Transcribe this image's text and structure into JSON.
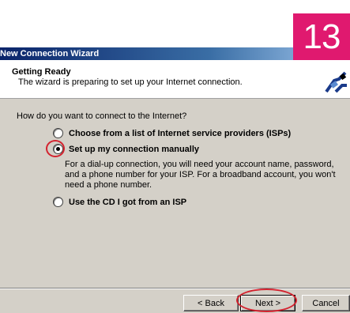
{
  "overlay": {
    "step_number": "13"
  },
  "window": {
    "title": "New Connection Wizard"
  },
  "header": {
    "title": "Getting Ready",
    "subtitle": "The wizard is preparing to set up your Internet connection."
  },
  "body": {
    "question": "How do you want to connect to the Internet?",
    "options": [
      {
        "label": "Choose from a list of Internet service providers (ISPs)",
        "selected": false
      },
      {
        "label": "Set up my connection manually",
        "selected": true
      },
      {
        "label": "Use the CD I got from an ISP",
        "selected": false
      }
    ],
    "manual_description": "For a dial-up connection, you will need your account name, password, and a phone number for your ISP. For a broadband account, you won't need a phone number."
  },
  "footer": {
    "back_label": "< Back",
    "next_label": "Next >",
    "cancel_label": "Cancel"
  },
  "colors": {
    "badge": "#e0196f",
    "annotation_red": "#d3232f",
    "titlebar_start": "#0a246a",
    "titlebar_end": "#a6caf0",
    "dialog_face": "#d4d0c8"
  }
}
